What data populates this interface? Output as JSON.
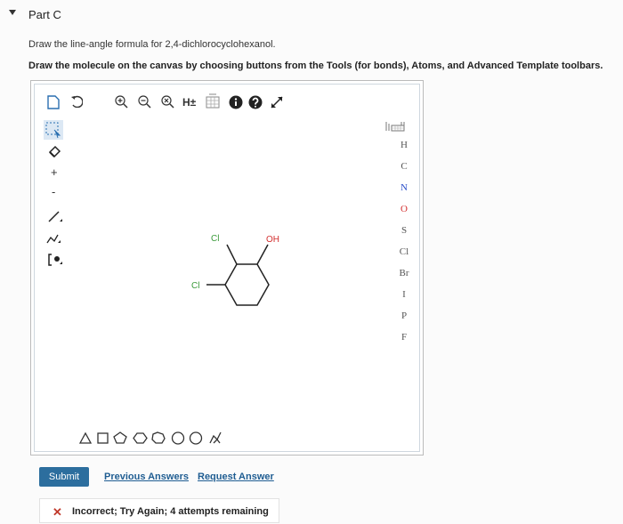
{
  "part": {
    "title": "Part C"
  },
  "instructions": {
    "line1": "Draw the line-angle formula for 2,4-dichlorocyclohexanol.",
    "line2": "Draw the molecule on the canvas by choosing buttons from the Tools (for bonds), Atoms, and Advanced Template toolbars."
  },
  "toolbar": {
    "hplus_label": "H±",
    "charge_plus": "+",
    "charge_minus": "-"
  },
  "atoms": [
    "H",
    "C",
    "N",
    "O",
    "S",
    "Cl",
    "Br",
    "I",
    "P",
    "F"
  ],
  "atom_colors": {
    "N": "#2b4fc9",
    "O": "#d32f2f",
    "default": "#555555"
  },
  "molecule": {
    "oh_label": "OH",
    "cl_top_label": "Cl",
    "cl_left_label": "Cl"
  },
  "actions": {
    "submit": "Submit",
    "previous_answers": "Previous Answers",
    "request_answer": "Request Answer"
  },
  "feedback": {
    "icon": "✕",
    "message": "Incorrect; Try Again; 4 attempts remaining"
  }
}
